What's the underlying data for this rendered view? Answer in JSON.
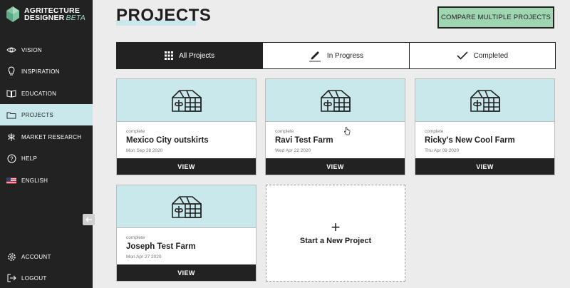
{
  "app": {
    "logo_line1": "AGRITECTURE",
    "logo_line2": "DESIGNER",
    "logo_beta": "BETA"
  },
  "sidebar": {
    "items": [
      {
        "label": "VISION",
        "icon": "eye-icon"
      },
      {
        "label": "INSPIRATION",
        "icon": "lightbulb-icon"
      },
      {
        "label": "EDUCATION",
        "icon": "book-icon"
      },
      {
        "label": "PROJECTS",
        "icon": "folder-icon",
        "active": true
      },
      {
        "label": "MARKET RESEARCH",
        "icon": "plant-icon"
      },
      {
        "label": "HELP",
        "icon": "help-icon"
      },
      {
        "label": "ENGLISH",
        "icon": "us-flag-icon"
      }
    ],
    "bottom": [
      {
        "label": "ACCOUNT",
        "icon": "gear-icon"
      },
      {
        "label": "LOGOUT",
        "icon": "logout-icon"
      }
    ]
  },
  "header": {
    "title": "PROJECTS",
    "compare_label": "COMPARE MULTIPLE PROJECTS"
  },
  "tabs": [
    {
      "label": "All Projects",
      "icon": "grid-icon",
      "active": true
    },
    {
      "label": "In Progress",
      "icon": "pencil-icon"
    },
    {
      "label": "Completed",
      "icon": "check-icon"
    }
  ],
  "projects": [
    {
      "status": "complete",
      "name": "Mexico City outskirts",
      "date": "Mon Sep 28 2020",
      "view_label": "VIEW"
    },
    {
      "status": "complete",
      "name": "Ravi Test Farm",
      "date": "Wed Apr 22 2020",
      "view_label": "VIEW"
    },
    {
      "status": "complete",
      "name": "Ricky's New Cool Farm",
      "date": "Thu Apr 09 2020",
      "view_label": "VIEW"
    },
    {
      "status": "complete",
      "name": "Joseph Test Farm",
      "date": "Mon Apr 27 2020",
      "view_label": "VIEW"
    }
  ],
  "new_project": {
    "plus": "+",
    "label": "Start a New Project"
  },
  "colors": {
    "sidebar_bg": "#222222",
    "accent_light_blue": "#c9e8ec",
    "compare_green": "#9fd5b1",
    "dark": "#222222"
  }
}
